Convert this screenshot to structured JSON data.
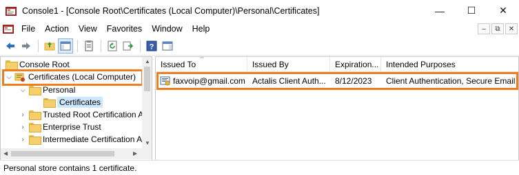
{
  "window": {
    "title": "Console1 - [Console Root\\Certificates (Local Computer)\\Personal\\Certificates]",
    "controls": {
      "minimize": "—",
      "maximize": "☐",
      "close": "✕"
    }
  },
  "menubar": {
    "items": [
      {
        "label": "File"
      },
      {
        "label": "Action"
      },
      {
        "label": "View"
      },
      {
        "label": "Favorites"
      },
      {
        "label": "Window"
      },
      {
        "label": "Help"
      }
    ],
    "mdi": {
      "minimize": "–",
      "restore": "⧉",
      "close": "✕"
    }
  },
  "toolbar": {
    "icons": [
      "back-arrow-icon",
      "forward-arrow-icon",
      "up-folder-icon",
      "show-hide-tree-icon",
      "properties-icon",
      "refresh-icon",
      "export-list-icon",
      "help-icon",
      "show-action-pane-icon"
    ]
  },
  "tree": {
    "items": [
      {
        "label": "Console Root",
        "level": 0
      },
      {
        "label": "Certificates (Local Computer)",
        "level": 1,
        "expanded": true,
        "highlighted": true
      },
      {
        "label": "Personal",
        "level": 2,
        "expanded": true
      },
      {
        "label": "Certificates",
        "level": 3,
        "selected": true
      },
      {
        "label": "Trusted Root Certification A",
        "level": 2
      },
      {
        "label": "Enterprise Trust",
        "level": 2
      },
      {
        "label": "Intermediate Certification A",
        "level": 2
      }
    ]
  },
  "list": {
    "columns": [
      {
        "label": "Issued To"
      },
      {
        "label": "Issued By"
      },
      {
        "label": "Expiration..."
      },
      {
        "label": "Intended Purposes"
      }
    ],
    "rows": [
      {
        "issued_to": "faxvoip@gmail.com",
        "issued_by": "Actalis Client Auth...",
        "expiration": "8/12/2023",
        "purposes": "Client Authentication, Secure Email",
        "highlighted": true
      }
    ]
  },
  "status": {
    "text": "Personal store contains 1 certificate."
  },
  "colors": {
    "highlight": "#ef7c1f",
    "selection": "#cce8ff",
    "accent": "#2a6dc3"
  }
}
